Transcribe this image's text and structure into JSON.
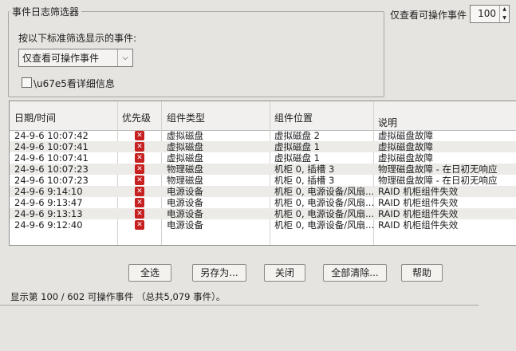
{
  "filter": {
    "group_title": "事件日志筛选器",
    "prompt": "按以下标准筛选显示的事件:",
    "selected": "仅查看可操作事件",
    "detail_checkbox_label": "\\u67e5看详细信息",
    "detail_checked": false
  },
  "top_right": {
    "label": "仅查看可操作事件",
    "count": "100"
  },
  "table": {
    "columns": [
      "日期/时间",
      "优先级",
      "组件类型",
      "组件位置",
      "说明"
    ],
    "rows": [
      {
        "datetime": "24-9-6 10:07:42",
        "type": "虚拟磁盘",
        "location": "虚拟磁盘 2",
        "description": "虚拟磁盘故障"
      },
      {
        "datetime": "24-9-6 10:07:41",
        "type": "虚拟磁盘",
        "location": "虚拟磁盘 1",
        "description": "虚拟磁盘故障"
      },
      {
        "datetime": "24-9-6 10:07:41",
        "type": "虚拟磁盘",
        "location": "虚拟磁盘 1",
        "description": "虚拟磁盘故障"
      },
      {
        "datetime": "24-9-6 10:07:23",
        "type": "物理磁盘",
        "location": "机柜 0, 插槽 3",
        "description": "物理磁盘故障 - 在日初无响应"
      },
      {
        "datetime": "24-9-6 10:07:23",
        "type": "物理磁盘",
        "location": "机柜 0, 插槽 3",
        "description": "物理磁盘故障 - 在日初无响应"
      },
      {
        "datetime": "24-9-6 9:14:10",
        "type": "电源设备",
        "location": "机柜 0, 电源设备/风扇...",
        "description": "RAID 机柜组件失效"
      },
      {
        "datetime": "24-9-6 9:13:47",
        "type": "电源设备",
        "location": "机柜 0, 电源设备/风扇...",
        "description": "RAID 机柜组件失效"
      },
      {
        "datetime": "24-9-6 9:13:13",
        "type": "电源设备",
        "location": "机柜 0, 电源设备/风扇...",
        "description": "RAID 机柜组件失效"
      },
      {
        "datetime": "24-9-6 9:12:40",
        "type": "电源设备",
        "location": "机柜 0, 电源设备/风扇...",
        "description": "RAID 机柜组件失效"
      }
    ]
  },
  "buttons": {
    "select_all": "全选",
    "save_as": "另存为...",
    "close": "关闭",
    "clear_all": "全部清除...",
    "help": "帮助"
  },
  "status": "显示第 100 / 602 可操作事件 （总共5,079 事件）。",
  "colors": {
    "error": "#c62020",
    "background": "#e6e4e0"
  },
  "icons": {
    "priority": "error-icon"
  }
}
